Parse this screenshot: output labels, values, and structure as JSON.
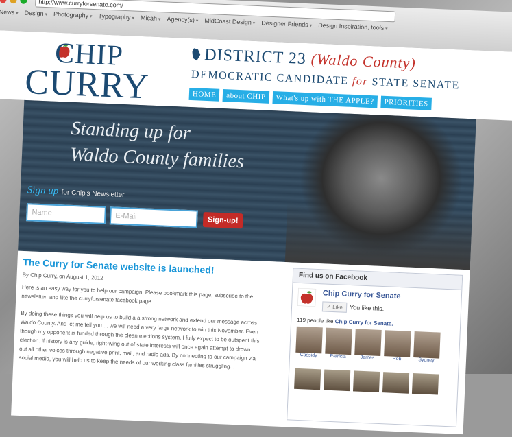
{
  "browser": {
    "url": "http://www.curryforsenate.com/",
    "bookmarks": [
      "News",
      "Design",
      "Photography",
      "Typography",
      "Micah",
      "Agency(s)",
      "MidCoast Design",
      "Designer Friends",
      "Design Inspiration, tools"
    ]
  },
  "header": {
    "logo_top": "CHIP",
    "logo_bottom": "CURRY",
    "district": "DISTRICT 23",
    "county": "(Waldo County)",
    "candidate_pre": "DEMOCRATIC CANDIDATE",
    "candidate_for": "for",
    "candidate_post": "STATE SENATE",
    "nav": [
      "HOME",
      "about CHIP",
      "What's up with THE APPLE?",
      "PRIORITIES"
    ]
  },
  "hero": {
    "tagline_line1": "Standing up for",
    "tagline_line2": "Waldo County families",
    "signup_label": "Sign up",
    "signup_sub": "for Chip's Newsletter",
    "name_placeholder": "Name",
    "email_placeholder": "E-Mail",
    "button": "Sign-up!"
  },
  "post": {
    "title": "The Curry for Senate website is launched!",
    "byline": "By Chip Curry, on August 1, 2012",
    "para1": "Here is an easy way for you to help our campaign. Please bookmark this page, subscribe to the newsletter, and like the curryforsenate facebook page.",
    "para2": "By doing these things you will help us to build a a strong network and extend our message across Waldo County. And let me tell you ... we will need a very large network to win this November. Even though my opponent is funded through the clean elections system, I fully expect to be outspent this election. If history is any guide, right-wing out of state interests will once again attempt to drown out all other voices through negative print, mail, and radio ads. By connecting to our campaign via social media, you will help us to keep the needs of our working class families struggling..."
  },
  "facebook": {
    "heading": "Find us on Facebook",
    "page_name": "Chip Curry for Senate",
    "like_button": "Like",
    "you_like": "You like this.",
    "count_text": "119 people like",
    "count_page": "Chip Curry for Senate.",
    "friends": [
      "Cassidy",
      "Patricia",
      "James",
      "Rob",
      "Sydney"
    ]
  },
  "colors": {
    "brand_navy": "#1c4a72",
    "accent_red": "#c4322b",
    "nav_blue": "#27aee6",
    "fb_blue": "#3b5998"
  }
}
